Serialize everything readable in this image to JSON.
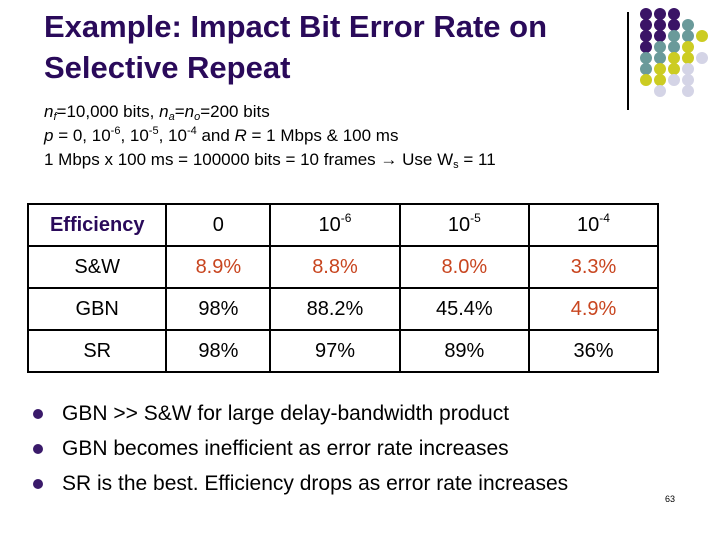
{
  "slide": {
    "title_line1": "Example:  Impact Bit Error Rate on",
    "title_line2": "Selective Repeat",
    "page_number": "63"
  },
  "info": {
    "line1": {
      "nf_var": "n",
      "nf_sub": "f",
      "nf_val": "=10,000 bits, ",
      "na_var": "n",
      "na_sub": "a",
      "eq": "=",
      "no_var": "n",
      "no_sub": "o",
      "no_val": "=200 bits"
    },
    "line2": {
      "p_var": "p",
      "p_eq": " = 0, 10",
      "e1": "-6",
      "sep1": ", 10",
      "e2": "-5",
      "sep2": ", 10",
      "e3": "-4",
      "and": " and  ",
      "r_var": "R",
      "r_val": " = 1 Mbps & 100 ms"
    },
    "line3": {
      "text": "1 Mbps x 100 ms = 100000 bits = 10 frames → Use W",
      "ws_sub": "s",
      "ws_val": " = 11"
    }
  },
  "table": {
    "header": {
      "label": "Efficiency",
      "cols": [
        {
          "base": "0",
          "exp": ""
        },
        {
          "base": "10",
          "exp": "-6"
        },
        {
          "base": "10",
          "exp": "-5"
        },
        {
          "base": "10",
          "exp": "-4"
        }
      ]
    },
    "rows": [
      {
        "label": "S&W",
        "values": [
          "8.9%",
          "8.8%",
          "8.0%",
          "3.3%"
        ],
        "highlight": [
          true,
          true,
          true,
          true
        ]
      },
      {
        "label": "GBN",
        "values": [
          "98%",
          "88.2%",
          "45.4%",
          "4.9%"
        ],
        "highlight": [
          false,
          false,
          false,
          true
        ]
      },
      {
        "label": "SR",
        "values": [
          "98%",
          "97%",
          "89%",
          "36%"
        ],
        "highlight": [
          false,
          false,
          false,
          false
        ]
      }
    ]
  },
  "bullets": [
    "GBN >> S&W for large delay-bandwidth product",
    "GBN becomes inefficient as error rate increases",
    "SR is the best.  Efficiency drops as error rate increases"
  ],
  "colors": {
    "title": "#2a0a5a",
    "highlight": "#c8451f",
    "dot_purple": "#3a1466",
    "dot_teal": "#6a9a9a",
    "dot_yellow": "#cccc22",
    "dot_lavender": "#d4d4e6"
  }
}
